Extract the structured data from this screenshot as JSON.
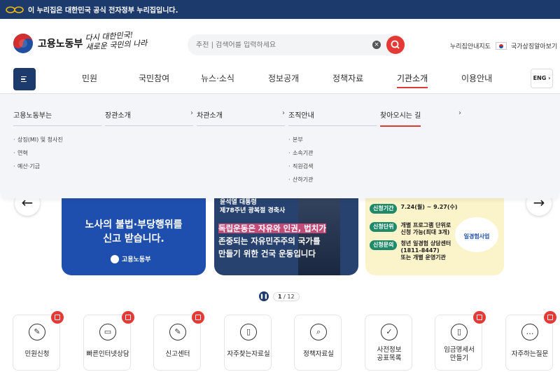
{
  "gov_banner": {
    "text": "이 누리집은 대한민국 공식 전자정부 누리집입니다."
  },
  "header": {
    "logo_name": "고용노동부",
    "slogan_line1": "다시 대한민국!",
    "slogan_line2": "새로운 국민의 나라",
    "search_placeholder": "추천 | 검색어를 입력하세요",
    "sitemap": "누리집안내지도",
    "symbols": "국가상징알아보기"
  },
  "gnb": {
    "items": [
      "민원",
      "국민참여",
      "뉴스·소식",
      "정보공개",
      "정책자료",
      "기관소개",
      "이용안내"
    ],
    "active_index": 5,
    "eng_label": "ENG"
  },
  "mega_menu": {
    "columns": [
      {
        "title": "고용노동부는",
        "has_chevron": false,
        "items": [
          "상징(MI) 및 청사진",
          "연혁",
          "예산·기금"
        ]
      },
      {
        "title": "장관소개",
        "has_chevron": true,
        "items": []
      },
      {
        "title": "차관소개",
        "has_chevron": true,
        "items": []
      },
      {
        "title": "조직안내",
        "has_chevron": false,
        "items": [
          "본부",
          "소속기관",
          "직원검색",
          "산하기관"
        ]
      },
      {
        "title": "찾아오시는 길",
        "has_chevron": true,
        "items": [],
        "active": true
      }
    ]
  },
  "hero": {
    "card1": {
      "text_line1": "노사의 불법·부당행위를",
      "text_line2": "신고 받습니다.",
      "logo": "고용노동부"
    },
    "card2": {
      "tag_line1": "윤석열 대통령",
      "tag_line2": "제78주년 광복절 경축사",
      "line1": "독립운동은 자유와 인권, 법치가",
      "line2": "존중되는 자유민주주의 국가를",
      "line3": "만들기 위한 건국 운동입니다"
    },
    "card3": {
      "rows": [
        {
          "pill": "신청기간",
          "text": "7.24(월) ~ 9.27(수)"
        },
        {
          "pill": "신청단위",
          "text": "개별 프로그램 단위로\n신청 가능(최대 3개)"
        },
        {
          "pill": "신청문의",
          "text": "청년 일경험 상담센터\n(1811-8447)\n또는 개별 운영기관"
        }
      ],
      "program": "일경험사업"
    }
  },
  "pager": {
    "current": "1",
    "total": "/ 12"
  },
  "quick_menu": [
    {
      "label": "민원신청",
      "icon": "pencil-icon"
    },
    {
      "label": "빠른인터넷상담",
      "icon": "monitor-icon"
    },
    {
      "label": "신고센터",
      "icon": "pencil-icon"
    },
    {
      "label": "자주찾는자료실",
      "icon": "bookmark-icon"
    },
    {
      "label": "정책자료실",
      "icon": "document-search-icon"
    },
    {
      "label": "사전정보\n공표목록",
      "icon": "clipboard-check-icon"
    },
    {
      "label": "임금명세서\n만들기",
      "icon": "bookmark-icon"
    },
    {
      "label": "자주하는질문",
      "icon": "chat-icon"
    }
  ]
}
